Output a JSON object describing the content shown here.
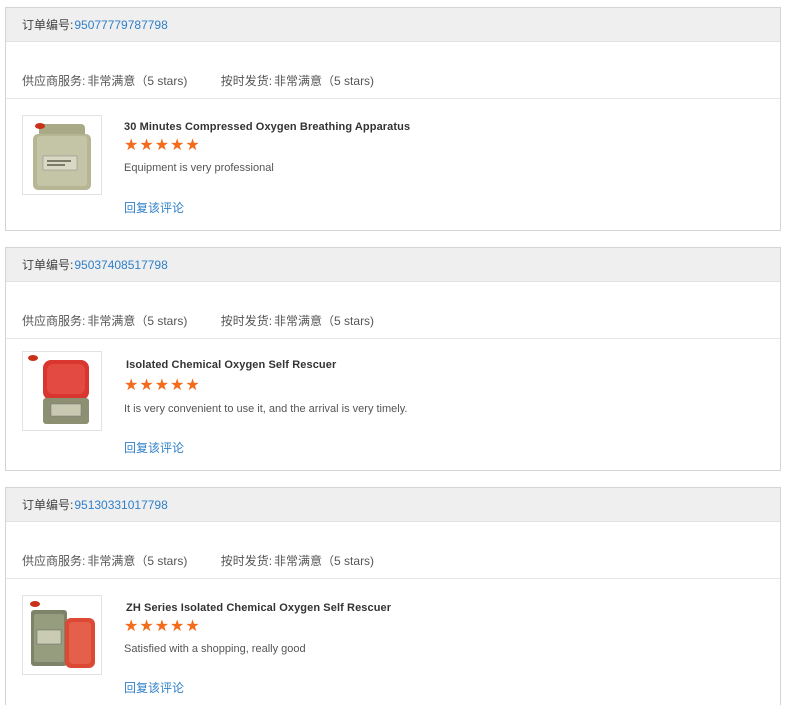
{
  "orders": [
    {
      "label": "订单编号:",
      "number": "95077779787798",
      "supplier_label": "供应商服务:",
      "supplier_value": "非常满意（5 stars)",
      "delivery_label": "按时发货:",
      "delivery_value": "非常满意（5 stars)",
      "product_name": "30 Minutes Compressed Oxygen Breathing Apparatus",
      "stars": "★★★★★",
      "rating": 5,
      "comment": "Equipment is very professional",
      "reply_label": "回复该评论"
    },
    {
      "label": "订单编号:",
      "number": "95037408517798",
      "supplier_label": "供应商服务:",
      "supplier_value": "非常满意（5 stars)",
      "delivery_label": "按时发货:",
      "delivery_value": "非常满意（5 stars)",
      "product_name": "Isolated Chemical Oxygen Self Rescuer",
      "stars": "★★★★★",
      "rating": 5,
      "comment": "It is very convenient to use it, and the arrival is very timely.",
      "reply_label": "回复该评论"
    },
    {
      "label": "订单编号:",
      "number": "95130331017798",
      "supplier_label": "供应商服务:",
      "supplier_value": "非常满意（5 stars)",
      "delivery_label": "按时发货:",
      "delivery_value": "非常满意（5 stars)",
      "product_name": "ZH Series Isolated Chemical Oxygen Self Rescuer",
      "stars": "★★★★★",
      "rating": 5,
      "comment": "Satisfied with a shopping, really good",
      "reply_label": "回复该评论"
    }
  ],
  "colors": {
    "link": "#2f7fc8",
    "star": "#f36c1c",
    "header_bg": "#efefef"
  }
}
